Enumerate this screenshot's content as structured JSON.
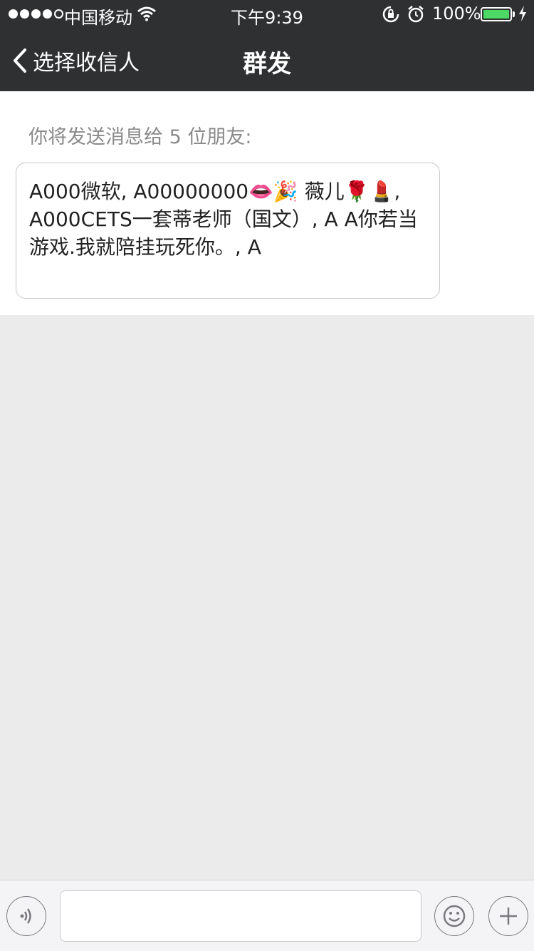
{
  "status_bar": {
    "carrier": "中国移动",
    "time": "下午9:39",
    "battery": "100%",
    "battery_level": 1.0
  },
  "nav": {
    "back_label": "选择收信人",
    "title": "群发"
  },
  "recipients": {
    "hint": "你将发送消息给 5 位朋友:",
    "list": "A000微软, A00000000👄🎉 薇儿🌹💄, A000CETS一套蒂老师（国文）, A A你若当游戏.我就陪挂玩死你。, A"
  },
  "input_bar": {
    "message_value": ""
  },
  "icons": {
    "back": "chevron-left-icon",
    "voice": "voice-icon",
    "emoji": "emoji-icon",
    "plus": "plus-icon"
  },
  "colors": {
    "nav_bg": "#2f3032",
    "battery_green": "#4cd964",
    "page_bg": "#ebebeb"
  }
}
